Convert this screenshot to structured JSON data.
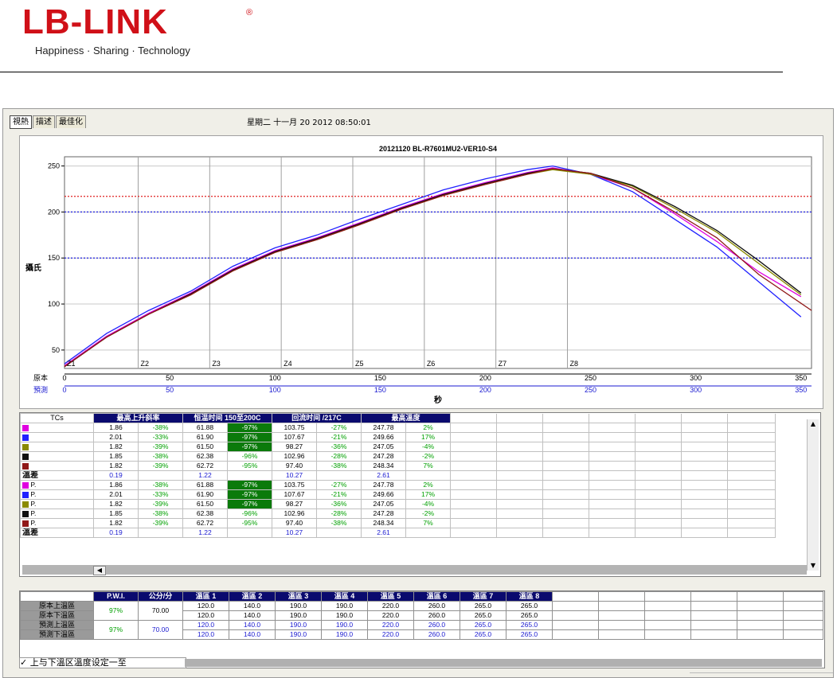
{
  "logo": {
    "text": "LB-LINK",
    "registered": "®",
    "tagline": "Happiness · Sharing · Technology"
  },
  "window": {
    "tabs": [
      {
        "label": "視熱"
      },
      {
        "label": "描述"
      },
      {
        "label": "最佳化"
      }
    ],
    "datetime": "星期二 十一月 20 2012 08:50:01"
  },
  "colors": {
    "accent_header": "#0a0a6e",
    "highlight": "#0b7a0b",
    "good_pct": "#00a000",
    "predicted": "#1a1ad0"
  },
  "chart": {
    "title": "20121120 BL-R7601MU2-VER10-S4",
    "ylabel": "攝氏",
    "xlabel": "秒",
    "row_label_original": "原本",
    "row_label_predicted": "預測",
    "zones": [
      "Z1",
      "Z2",
      "Z3",
      "Z4",
      "Z5",
      "Z6",
      "Z7",
      "Z8"
    ]
  },
  "chart_data": {
    "type": "line",
    "title": "20121120 BL-R7601MU2-VER10-S4",
    "xlabel": "秒",
    "ylabel": "攝氏",
    "xlim": [
      0,
      355
    ],
    "ylim": [
      30,
      260
    ],
    "x_ticks": [
      0,
      50,
      100,
      150,
      200,
      250,
      300,
      350
    ],
    "y_ticks": [
      50,
      100,
      150,
      200,
      250
    ],
    "zone_boundaries": [
      0,
      35,
      69,
      103,
      137,
      171,
      205,
      239
    ],
    "reference_lines": [
      {
        "y": 217,
        "color": "#e02020"
      },
      {
        "y": 200,
        "color": "#2020e0"
      },
      {
        "y": 150,
        "color": "#2020e0"
      }
    ],
    "grid": true,
    "series": [
      {
        "color": "#e000e0",
        "x": [
          0,
          20,
          40,
          60,
          80,
          100,
          120,
          140,
          160,
          180,
          200,
          220,
          232,
          250,
          270,
          290,
          310,
          330,
          350
        ],
        "y": [
          33,
          65,
          90,
          112,
          138,
          158,
          172,
          188,
          205,
          220,
          232,
          243,
          248,
          241,
          226,
          198,
          168,
          135,
          108
        ]
      },
      {
        "color": "#2020ff",
        "x": [
          0,
          20,
          40,
          60,
          80,
          100,
          120,
          140,
          160,
          180,
          200,
          220,
          232,
          250,
          270,
          290,
          310,
          330,
          350
        ],
        "y": [
          35,
          68,
          93,
          114,
          141,
          161,
          175,
          192,
          208,
          224,
          236,
          246,
          250,
          241,
          222,
          192,
          162,
          124,
          86
        ]
      },
      {
        "color": "#8a8a00",
        "x": [
          0,
          20,
          40,
          60,
          80,
          100,
          120,
          140,
          160,
          180,
          200,
          220,
          232,
          250,
          270,
          290,
          310,
          330,
          350
        ],
        "y": [
          32,
          64,
          89,
          110,
          136,
          156,
          170,
          186,
          203,
          218,
          230,
          241,
          246,
          241,
          228,
          204,
          178,
          144,
          110
        ]
      },
      {
        "color": "#101010",
        "x": [
          0,
          20,
          40,
          60,
          80,
          100,
          120,
          140,
          160,
          180,
          200,
          220,
          232,
          250,
          270,
          290,
          310,
          330,
          350
        ],
        "y": [
          32,
          64,
          89,
          111,
          137,
          157,
          171,
          187,
          204,
          219,
          231,
          242,
          247,
          242,
          229,
          206,
          180,
          147,
          112
        ]
      },
      {
        "color": "#901818",
        "x": [
          0,
          20,
          40,
          60,
          80,
          100,
          120,
          140,
          160,
          180,
          200,
          220,
          232,
          250,
          270,
          290,
          310,
          330,
          355
        ],
        "y": [
          32,
          64,
          89,
          110,
          136,
          156,
          170,
          186,
          203,
          218,
          230,
          241,
          247,
          242,
          226,
          200,
          172,
          132,
          93
        ]
      }
    ]
  },
  "table": {
    "headers": {
      "tcs": "TCs",
      "max_slope": "最高上升斜率",
      "soak": "恒温时间 150至200C",
      "reflow": "回流时间 /217C",
      "peak": "最高溫度"
    },
    "rows": [
      {
        "color": "#e000e0",
        "label": "",
        "slope": "1.86",
        "slope_pct": "-38%",
        "soak": "61.88",
        "soak_pct": "-97%",
        "soak_hl": true,
        "reflow": "103.75",
        "reflow_pct": "-27%",
        "peak": "247.78",
        "peak_pct": "2%"
      },
      {
        "color": "#2020ff",
        "label": "",
        "slope": "2.01",
        "slope_pct": "-33%",
        "soak": "61.90",
        "soak_pct": "-97%",
        "soak_hl": true,
        "reflow": "107.67",
        "reflow_pct": "-21%",
        "peak": "249.66",
        "peak_pct": "17%"
      },
      {
        "color": "#8a8a00",
        "label": "",
        "slope": "1.82",
        "slope_pct": "-39%",
        "soak": "61.50",
        "soak_pct": "-97%",
        "soak_hl": true,
        "reflow": "98.27",
        "reflow_pct": "-36%",
        "peak": "247.05",
        "peak_pct": "-4%"
      },
      {
        "color": "#101010",
        "label": "",
        "slope": "1.85",
        "slope_pct": "-38%",
        "soak": "62.38",
        "soak_pct": "-96%",
        "soak_hl": false,
        "reflow": "102.96",
        "reflow_pct": "-28%",
        "peak": "247.28",
        "peak_pct": "-2%"
      },
      {
        "color": "#901818",
        "label": "",
        "slope": "1.82",
        "slope_pct": "-39%",
        "soak": "62.72",
        "soak_pct": "-95%",
        "soak_hl": false,
        "reflow": "97.40",
        "reflow_pct": "-38%",
        "peak": "248.34",
        "peak_pct": "7%"
      }
    ],
    "diff": {
      "label": "溫差",
      "slope": "0.19",
      "soak": "1.22",
      "reflow": "10.27",
      "peak": "2.61"
    },
    "pred_rows": [
      {
        "color": "#e000e0",
        "label": "P.",
        "slope": "1.86",
        "slope_pct": "-38%",
        "soak": "61.88",
        "soak_pct": "-97%",
        "soak_hl": true,
        "reflow": "103.75",
        "reflow_pct": "-27%",
        "peak": "247.78",
        "peak_pct": "2%"
      },
      {
        "color": "#2020ff",
        "label": "P.",
        "slope": "2.01",
        "slope_pct": "-33%",
        "soak": "61.90",
        "soak_pct": "-97%",
        "soak_hl": true,
        "reflow": "107.67",
        "reflow_pct": "-21%",
        "peak": "249.66",
        "peak_pct": "17%"
      },
      {
        "color": "#8a8a00",
        "label": "P.",
        "slope": "1.82",
        "slope_pct": "-39%",
        "soak": "61.50",
        "soak_pct": "-97%",
        "soak_hl": true,
        "reflow": "98.27",
        "reflow_pct": "-36%",
        "peak": "247.05",
        "peak_pct": "-4%"
      },
      {
        "color": "#101010",
        "label": "P.",
        "slope": "1.85",
        "slope_pct": "-38%",
        "soak": "62.38",
        "soak_pct": "-96%",
        "soak_hl": false,
        "reflow": "102.96",
        "reflow_pct": "-28%",
        "peak": "247.28",
        "peak_pct": "-2%"
      },
      {
        "color": "#901818",
        "label": "P.",
        "slope": "1.82",
        "slope_pct": "-39%",
        "soak": "62.72",
        "soak_pct": "-95%",
        "soak_hl": false,
        "reflow": "97.40",
        "reflow_pct": "-38%",
        "peak": "248.34",
        "peak_pct": "7%"
      }
    ],
    "pred_diff": {
      "label": "溫差",
      "slope": "0.19",
      "soak": "1.22",
      "reflow": "10.27",
      "peak": "2.61"
    }
  },
  "scroll": {
    "up": "▲",
    "down": "▼",
    "left": "◀"
  },
  "zones": {
    "headers": {
      "pwi": "P.W.I.",
      "speed": "公分/分",
      "zones": [
        "溫區 1",
        "溫區 2",
        "溫區 3",
        "溫區 4",
        "溫區 5",
        "溫區 6",
        "溫區 7",
        "溫區 8"
      ]
    },
    "rows": [
      {
        "label": "原本上溫區",
        "values": [
          "120.0",
          "140.0",
          "190.0",
          "190.0",
          "220.0",
          "260.0",
          "265.0",
          "265.0"
        ]
      },
      {
        "label": "原本下溫區",
        "values": [
          "120.0",
          "140.0",
          "190.0",
          "190.0",
          "220.0",
          "260.0",
          "265.0",
          "265.0"
        ]
      },
      {
        "label": "預測上溫區",
        "values": [
          "120.0",
          "140.0",
          "190.0",
          "190.0",
          "220.0",
          "260.0",
          "265.0",
          "265.0"
        ]
      },
      {
        "label": "預測下溫區",
        "values": [
          "120.0",
          "140.0",
          "190.0",
          "190.0",
          "220.0",
          "260.0",
          "265.0",
          "265.0"
        ]
      }
    ],
    "original": {
      "pwi": "97%",
      "speed": "70.00"
    },
    "predicted": {
      "pwi": "97%",
      "speed": "70.00"
    },
    "sync_label": "✓ 上与下溫区溫度设定一至"
  }
}
